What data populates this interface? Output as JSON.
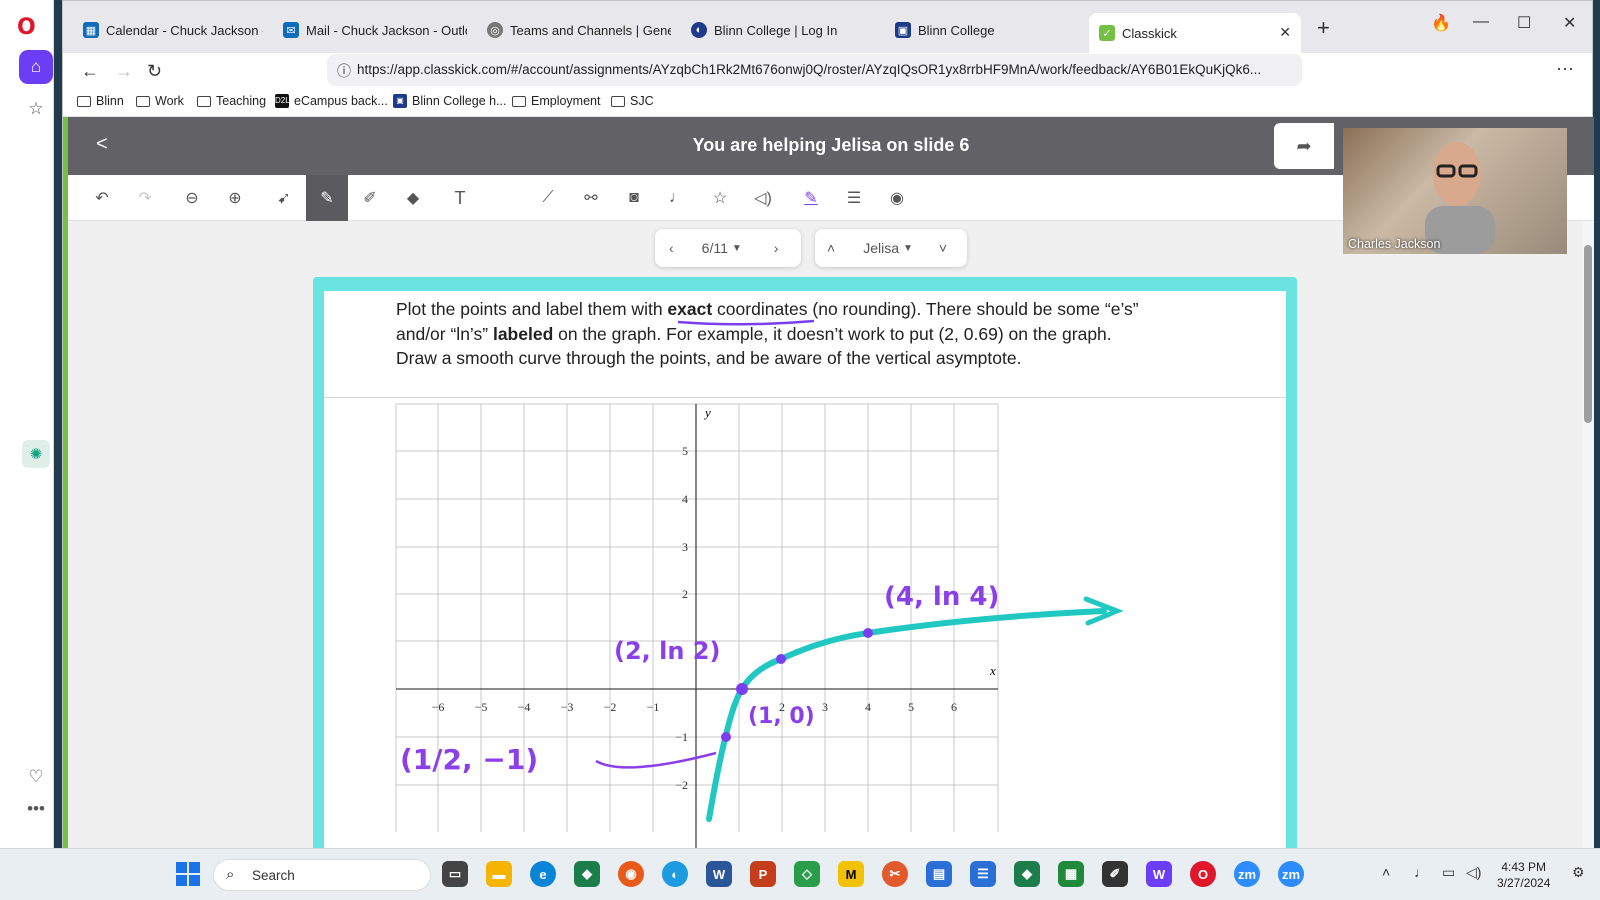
{
  "browser": {
    "tabs": [
      {
        "label": "Calendar - Chuck Jackson - Ou",
        "color": "#0f6cbd"
      },
      {
        "label": "Mail - Chuck Jackson - Outlook",
        "color": "#0f6cbd"
      },
      {
        "label": "Teams and Channels | General",
        "color": "#666666"
      },
      {
        "label": "Blinn College | Log In",
        "color": "#1d3b8a"
      },
      {
        "label": "Blinn College",
        "color": "#1d3b8a"
      },
      {
        "label": "Classkick",
        "color": "#74c044"
      }
    ],
    "url": "https://app.classkick.com/#/account/assignments/AYzqbCh1Rk2Mt676onwj0Q/roster/AYzqIQsOR1yx8rrbHF9MnA/work/feedback/AY6B01EkQuKjQk6...",
    "bookmarks": [
      "Blinn",
      "Work",
      "Teaching",
      "eCampus back...",
      "Blinn College h...",
      "Employment",
      "SJC"
    ]
  },
  "app": {
    "help_title": "You are helping Jelisa on slide 6",
    "slide_counter": "6/11",
    "student_name": "Jelisa",
    "accent": "#6be3e0",
    "instructions": {
      "line1_a": "Plot the points and label them with ",
      "line1_b": "exact",
      "line1_c": " coordinates (no rounding). There should be some “e’s”",
      "line2_a": "and/or “ln’s” ",
      "line2_b": "labeled",
      "line2_c": " on the graph. For example, it doesn’t work to put (2, 0.69) on the graph.",
      "line3": "Draw a smooth curve through the points, and be aware of the vertical asymptote."
    },
    "graph": {
      "x_label": "x",
      "y_label": "y",
      "x_ticks": [
        "−6",
        "−5",
        "−4",
        "−3",
        "−2",
        "−1",
        "2",
        "3",
        "4",
        "5",
        "6"
      ],
      "y_ticks": [
        "5",
        "4",
        "3",
        "2",
        "−1",
        "−2"
      ],
      "handwritten_labels": [
        "(4, ln 4)",
        "(2, ln 2)",
        "(1, 0)",
        "(1/2, −1)"
      ]
    }
  },
  "webcam": {
    "name": "Charles Jackson"
  },
  "taskbar": {
    "search_placeholder": "Search",
    "time": "4:43 PM",
    "date": "3/27/2024"
  }
}
